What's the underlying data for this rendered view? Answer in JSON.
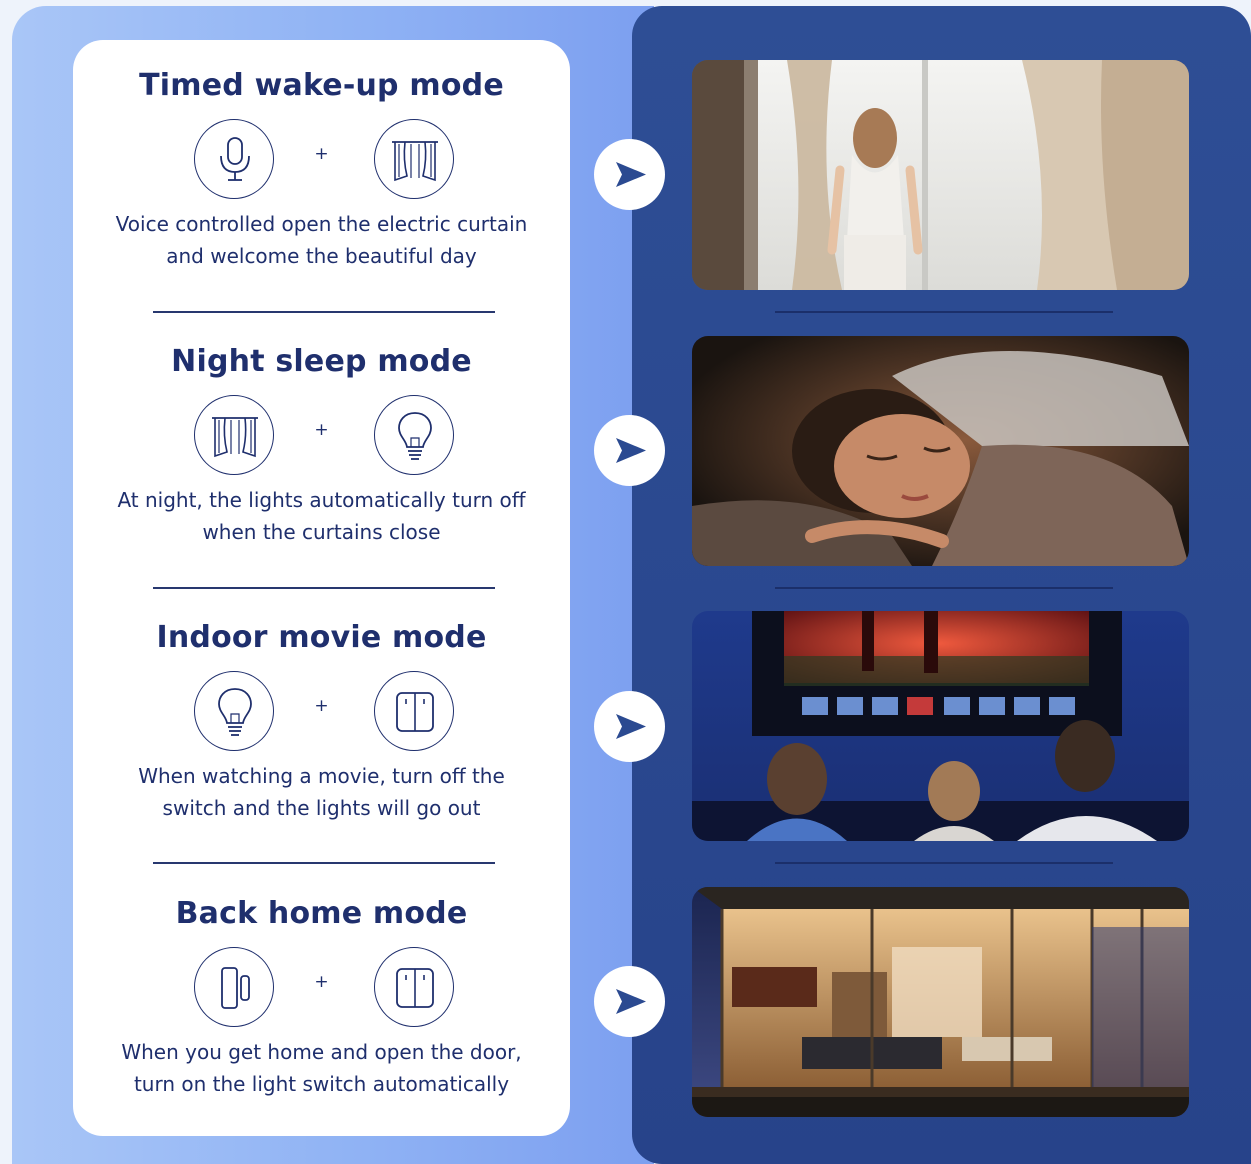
{
  "modes": [
    {
      "title": "Timed wake-up mode",
      "icon_a": "microphone-icon",
      "plus": "+",
      "icon_b": "curtain-icon",
      "desc_line1": "Voice controlled open the electric curtain",
      "desc_line2": "and welcome the beautiful day",
      "photo": "woman opening curtains at window"
    },
    {
      "title": "Night sleep mode",
      "icon_a": "curtain-icon",
      "plus": "+",
      "icon_b": "light-bulb-icon",
      "desc_line1": "At night, the lights automatically turn off",
      "desc_line2": "when the curtains close",
      "photo": "woman sleeping in dark bedroom"
    },
    {
      "title": "Indoor movie mode",
      "icon_a": "light-bulb-icon",
      "plus": "+",
      "icon_b": "wall-switch-icon",
      "desc_line1": "When watching a movie, turn off the",
      "desc_line2": "switch and the lights will go out",
      "photo": "family watching football on large TV"
    },
    {
      "title": "Back home mode",
      "icon_a": "door-sensor-icon",
      "plus": "+",
      "icon_b": "wall-switch-icon",
      "desc_line1": "When you get home and open the door,",
      "desc_line2": "turn on the light switch automatically",
      "photo": "lit modern house at dusk"
    }
  ],
  "colors": {
    "navy_text": "#1f2f6d",
    "right_panel": "#2b4a91",
    "left_gradient_start": "#a9c6f7",
    "left_gradient_end": "#7c9ff0",
    "card": "#ffffff"
  },
  "arrow_icon": "arrow-right-icon"
}
